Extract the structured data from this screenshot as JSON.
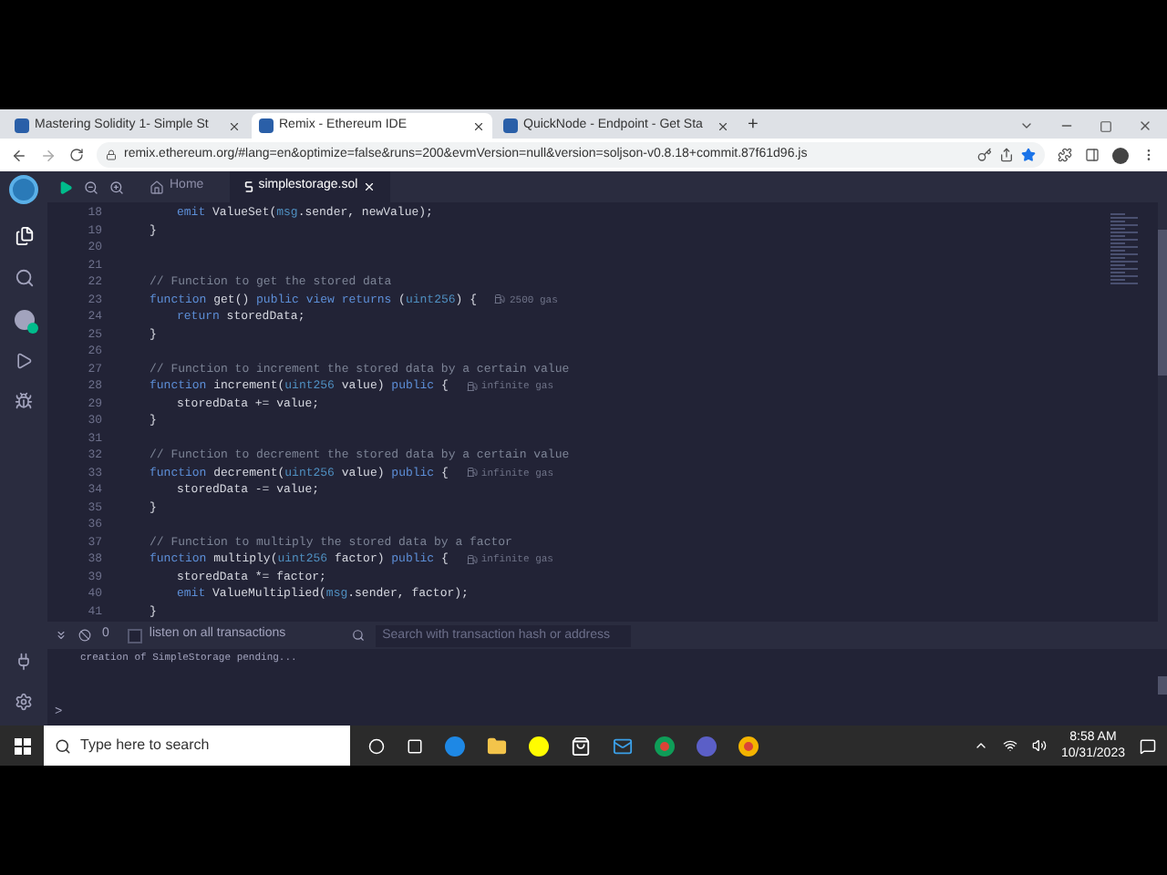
{
  "browser": {
    "tabs": [
      {
        "title": "Mastering Solidity 1- Simple St",
        "selected": false
      },
      {
        "title": "Remix - Ethereum IDE",
        "selected": true
      },
      {
        "title": "QuickNode - Endpoint - Get Sta",
        "selected": false
      }
    ],
    "new_tab": "+",
    "url": "remix.ethereum.org/#lang=en&optimize=false&runs=200&evmVersion=null&version=soljson-v0.8.18+commit.87f61d96.js"
  },
  "editor": {
    "tabs": [
      {
        "label": "Home",
        "kind": "home",
        "selected": false
      },
      {
        "label": "simplestorage.sol",
        "kind": "file",
        "selected": true
      }
    ],
    "lines": [
      {
        "number": "18",
        "kind": "inner",
        "tokens": [
          {
            "kind": "keyword",
            "text": "emit"
          },
          {
            "kind": "plain",
            "text": " ValueSet("
          },
          {
            "kind": "builtin",
            "text": "msg"
          },
          {
            "kind": "plain",
            "text": ".sender, newValue);"
          }
        ]
      },
      {
        "number": "19",
        "kind": "outer",
        "tokens": [
          {
            "kind": "plain",
            "text": "}"
          }
        ]
      },
      {
        "number": "20",
        "kind": "outer"
      },
      {
        "number": "21",
        "kind": "outer"
      },
      {
        "number": "22",
        "kind": "outer",
        "tokens": [
          {
            "kind": "comment",
            "text": "// Function to get the stored data"
          }
        ]
      },
      {
        "number": "23",
        "kind": "outer",
        "tokens": [
          {
            "kind": "keyword",
            "text": "function"
          },
          {
            "kind": "plain",
            "text": " get() "
          },
          {
            "kind": "keyword",
            "text": "public view returns"
          },
          {
            "kind": "plain",
            "text": " ("
          },
          {
            "kind": "builtin",
            "text": "uint256"
          },
          {
            "kind": "plain",
            "text": ") {"
          }
        ],
        "gas": "2500 gas"
      },
      {
        "number": "24",
        "kind": "inner",
        "tokens": [
          {
            "kind": "keyword",
            "text": "return"
          },
          {
            "kind": "plain",
            "text": " storedData;"
          }
        ]
      },
      {
        "number": "25",
        "kind": "outer",
        "tokens": [
          {
            "kind": "plain",
            "text": "}"
          }
        ]
      },
      {
        "number": "26",
        "kind": "outer"
      },
      {
        "number": "27",
        "kind": "outer",
        "tokens": [
          {
            "kind": "comment",
            "text": "// Function to increment the stored data by a certain value"
          }
        ]
      },
      {
        "number": "28",
        "kind": "outer",
        "tokens": [
          {
            "kind": "keyword",
            "text": "function"
          },
          {
            "kind": "plain",
            "text": " increment("
          },
          {
            "kind": "builtin",
            "text": "uint256"
          },
          {
            "kind": "plain",
            "text": " value) "
          },
          {
            "kind": "keyword",
            "text": "public"
          },
          {
            "kind": "plain",
            "text": " {"
          }
        ],
        "gas": "infinite gas"
      },
      {
        "number": "29",
        "kind": "inner",
        "tokens": [
          {
            "kind": "plain",
            "text": "storedData += value;"
          }
        ]
      },
      {
        "number": "30",
        "kind": "outer",
        "tokens": [
          {
            "kind": "plain",
            "text": "}"
          }
        ]
      },
      {
        "number": "31",
        "kind": "outer"
      },
      {
        "number": "32",
        "kind": "outer",
        "tokens": [
          {
            "kind": "comment",
            "text": "// Function to decrement the stored data by a certain value"
          }
        ]
      },
      {
        "number": "33",
        "kind": "outer",
        "tokens": [
          {
            "kind": "keyword",
            "text": "function"
          },
          {
            "kind": "plain",
            "text": " decrement("
          },
          {
            "kind": "builtin",
            "text": "uint256"
          },
          {
            "kind": "plain",
            "text": " value) "
          },
          {
            "kind": "keyword",
            "text": "public"
          },
          {
            "kind": "plain",
            "text": " {"
          }
        ],
        "gas": "infinite gas"
      },
      {
        "number": "34",
        "kind": "inner",
        "tokens": [
          {
            "kind": "plain",
            "text": "storedData -= value;"
          }
        ]
      },
      {
        "number": "35",
        "kind": "outer",
        "tokens": [
          {
            "kind": "plain",
            "text": "}"
          }
        ]
      },
      {
        "number": "36",
        "kind": "outer"
      },
      {
        "number": "37",
        "kind": "outer",
        "tokens": [
          {
            "kind": "comment",
            "text": "// Function to multiply the stored data by a factor"
          }
        ]
      },
      {
        "number": "38",
        "kind": "outer",
        "tokens": [
          {
            "kind": "keyword",
            "text": "function"
          },
          {
            "kind": "plain",
            "text": " multiply("
          },
          {
            "kind": "builtin",
            "text": "uint256"
          },
          {
            "kind": "plain",
            "text": " factor) "
          },
          {
            "kind": "keyword",
            "text": "public"
          },
          {
            "kind": "plain",
            "text": " {"
          }
        ],
        "gas": "infinite gas"
      },
      {
        "number": "39",
        "kind": "inner",
        "tokens": [
          {
            "kind": "plain",
            "text": "storedData *= factor;"
          }
        ]
      },
      {
        "number": "40",
        "kind": "inner",
        "tokens": [
          {
            "kind": "keyword",
            "text": "emit"
          },
          {
            "kind": "plain",
            "text": " ValueMultiplied("
          },
          {
            "kind": "builtin",
            "text": "msg"
          },
          {
            "kind": "plain",
            "text": ".sender, factor);"
          }
        ]
      },
      {
        "number": "41",
        "kind": "outer",
        "tokens": [
          {
            "kind": "plain",
            "text": "}"
          }
        ]
      }
    ]
  },
  "terminal": {
    "count": "0",
    "listen": {
      "label": "listen on all transactions",
      "checked": false
    },
    "search": {
      "placeholder": "Search with transaction hash or address"
    },
    "log": "creation of SimpleStorage pending...",
    "prompt": ">"
  },
  "taskbar": {
    "search": {
      "placeholder": "Type here to search"
    },
    "time": "8:58 AM",
    "date": "10/31/2023"
  }
}
